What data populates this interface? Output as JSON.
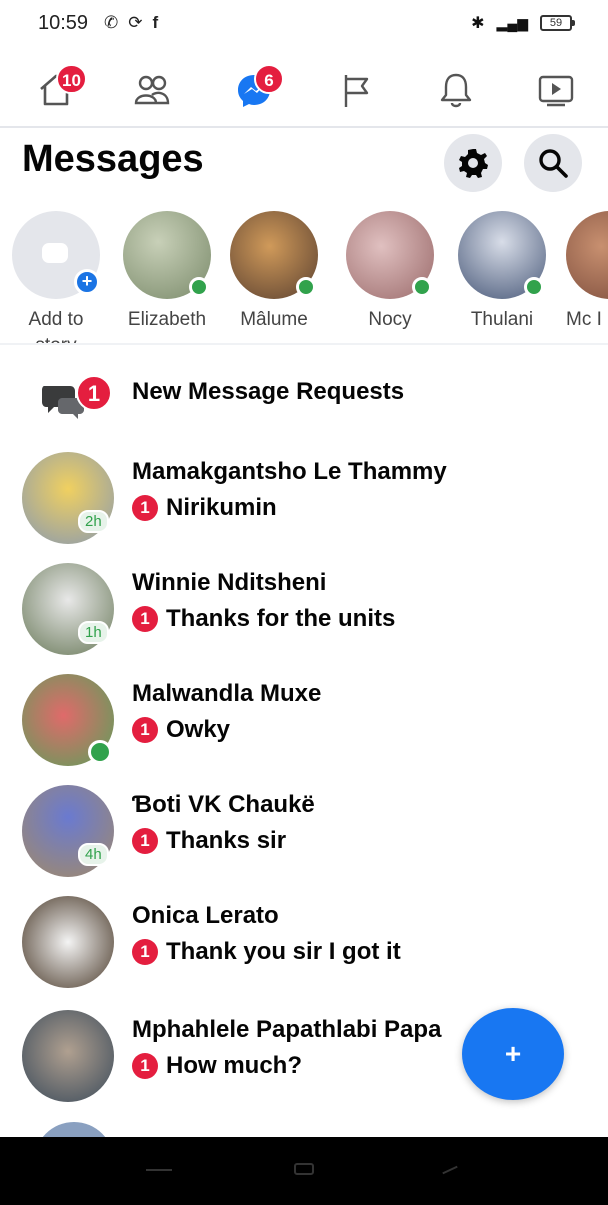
{
  "status_bar": {
    "time": "10:59",
    "left_icons": [
      "whatsapp-icon",
      "sync-icon",
      "facebook-icon"
    ],
    "right_icons": [
      "bluetooth-icon",
      "signal-icon"
    ],
    "battery": "59"
  },
  "top_nav": {
    "items": [
      {
        "icon": "home-icon",
        "badge": "10"
      },
      {
        "icon": "friends-icon",
        "badge": ""
      },
      {
        "icon": "messenger-icon",
        "badge": "6",
        "active": true
      },
      {
        "icon": "flag-icon",
        "badge": ""
      },
      {
        "icon": "bell-icon",
        "badge": ""
      },
      {
        "icon": "video-icon",
        "badge": ""
      }
    ],
    "active_color": "#1877f2"
  },
  "header": {
    "title": "Messages",
    "buttons": [
      "settings-icon",
      "search-icon"
    ]
  },
  "stories": [
    {
      "label_line1": "Add to",
      "label_line2": "story",
      "type": "add"
    },
    {
      "label": "Elizabeth",
      "online": true,
      "color": "#8a9a7a"
    },
    {
      "label": "Mâlume",
      "online": true,
      "color": "#7a5a3a"
    },
    {
      "label": "Nocy",
      "online": true,
      "color": "#b07a7a"
    },
    {
      "label": "Thulani",
      "online": true,
      "color": "#5a6a8a"
    },
    {
      "label": "Mc I",
      "online": false,
      "color": "#9a6a5a"
    }
  ],
  "requests": {
    "label": "New Message Requests",
    "count": "1"
  },
  "conversations": [
    {
      "name": "Mamakgantsho Le Thammy",
      "unread": "1",
      "message": "Nirikumin",
      "time": "2h",
      "online": false,
      "color": "#c8a04a"
    },
    {
      "name": "Winnie Nditsheni",
      "unread": "1",
      "message": "Thanks for the units",
      "time": "1h",
      "online": false,
      "color": "#7a8a6a"
    },
    {
      "name": "Malwandla Muxe",
      "unread": "1",
      "message": "Owky",
      "time": "",
      "online": true,
      "color": "#6aa06a"
    },
    {
      "name": "Ɓoti VK Chaukë",
      "unread": "1",
      "message": "Thanks sir",
      "time": "4h",
      "online": false,
      "color": "#a08a6a"
    },
    {
      "name": "Onica Lerato",
      "unread": "1",
      "message": "Thank you sir I got it",
      "time": "",
      "online": false,
      "color": "#5a4a3a"
    },
    {
      "name": "Mphahlele Papathlabi Papa",
      "unread": "1",
      "message": "How much?",
      "time": "",
      "online": false,
      "color": "#4a5a6a"
    }
  ],
  "fab": {
    "label": "+"
  },
  "colors": {
    "accent": "#1877f2",
    "badge": "#e41e3f",
    "online": "#31a24c"
  }
}
